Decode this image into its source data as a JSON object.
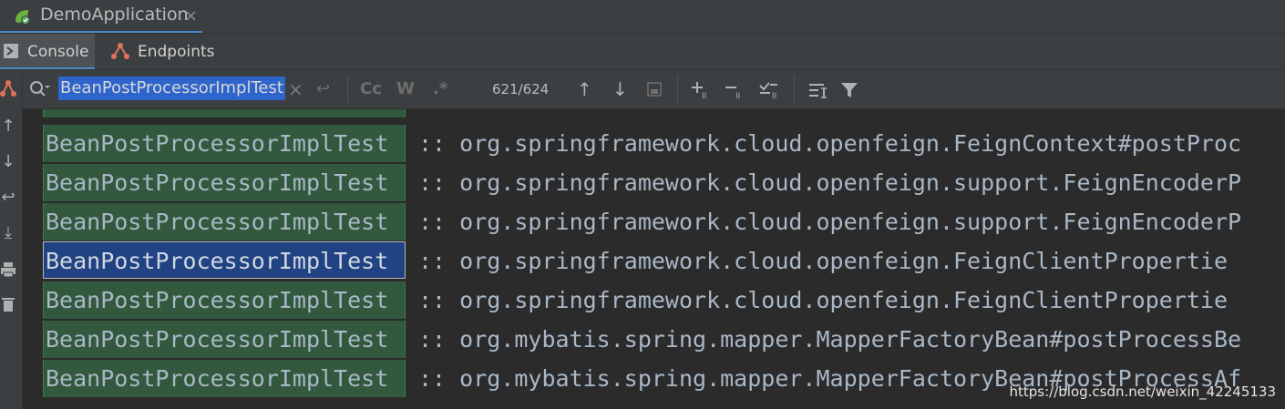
{
  "run_tab": {
    "title": "DemoApplication",
    "close_glyph": "×"
  },
  "sub_tabs": [
    {
      "label": "Console",
      "active": true,
      "icon": "console-icon"
    },
    {
      "label": "Endpoints",
      "active": false,
      "icon": "endpoints-icon"
    }
  ],
  "search": {
    "query": "BeanPostProcessorImplTest",
    "match_case": "Cc",
    "words": "W",
    "regex": ".*",
    "match_count": "621/624"
  },
  "console": {
    "rows": [
      {
        "match": "BeanPostProcessorImplTest",
        "rest": ":: org.springframework.cloud.openfeign.FeignContext#postProc",
        "current": false
      },
      {
        "match": "BeanPostProcessorImplTest",
        "rest": ":: org.springframework.cloud.openfeign.support.FeignEncoderP",
        "current": false
      },
      {
        "match": "BeanPostProcessorImplTest",
        "rest": ":: org.springframework.cloud.openfeign.support.FeignEncoderP",
        "current": false
      },
      {
        "match": "BeanPostProcessorImplTest",
        "rest": ":: org.springframework.cloud.openfeign.FeignClientPropertie",
        "current": true
      },
      {
        "match": "BeanPostProcessorImplTest",
        "rest": ":: org.springframework.cloud.openfeign.FeignClientPropertie",
        "current": false
      },
      {
        "match": "BeanPostProcessorImplTest",
        "rest": ":: org.mybatis.spring.mapper.MapperFactoryBean#postProcessBe",
        "current": false
      },
      {
        "match": "BeanPostProcessorImplTest",
        "rest": ":: org.mybatis.spring.mapper.MapperFactoryBean#postProcessAf",
        "current": false
      }
    ]
  },
  "watermark": "https://blog.csdn.net/weixin_42245133",
  "colors": {
    "accent": "#4a88c7",
    "match_bg": "#32593d",
    "current_match_bg": "#214283",
    "selection": "#2f65ca"
  }
}
